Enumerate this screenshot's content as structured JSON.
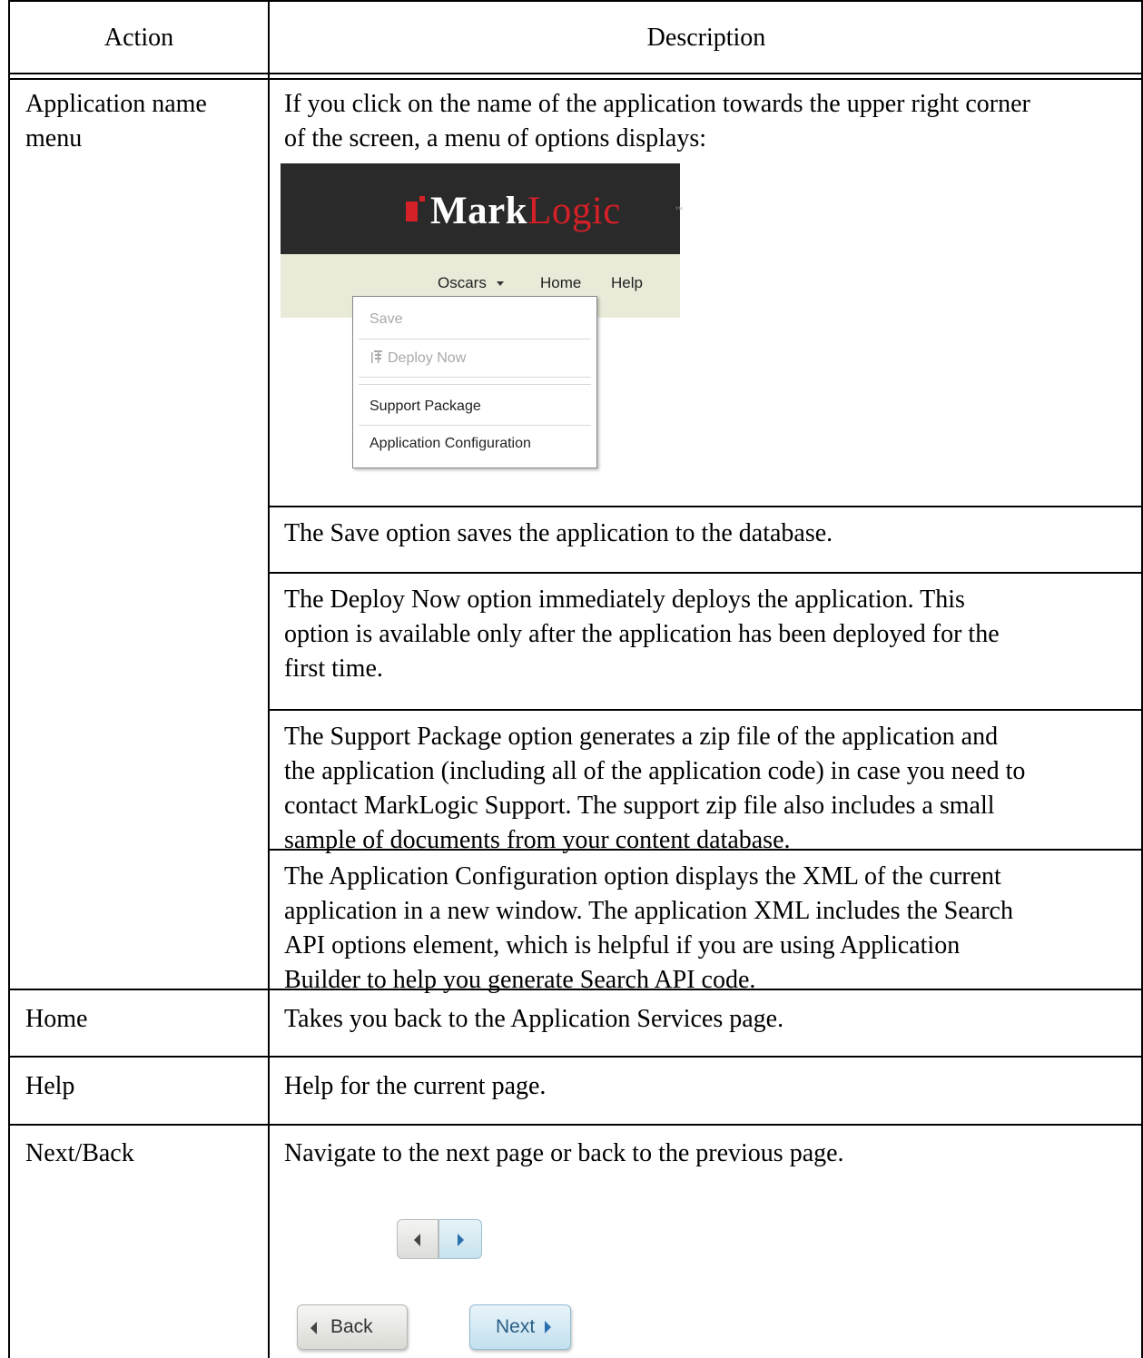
{
  "table": {
    "header": {
      "action": "Action",
      "description": "Description"
    },
    "rows": [
      {
        "action": [
          "Application name",
          "menu"
        ],
        "intro": [
          "If you click on the name of the application towards the upper right corner",
          "of the screen, a menu of options displays:"
        ],
        "sub": [
          [
            "The Save option saves the application to the database."
          ],
          [
            "The Deploy Now option immediately deploys the application. This",
            "option is available only after the application has been deployed for the",
            "first time."
          ],
          [
            "The Support Package option generates a zip file of the application and",
            "the application (including all of the application code) in case you need to",
            "contact MarkLogic Support. The support zip file also includes a small",
            "sample of documents from your content database."
          ],
          [
            "The Application Configuration option displays the XML of the current",
            "application in a new window. The application XML includes the Search",
            "API options element, which is helpful if you are using Application",
            "Builder to help you generate Search API code."
          ]
        ]
      },
      {
        "action": "Home",
        "description": "Takes you back to the Application Services page."
      },
      {
        "action": "Help",
        "description": "Help for the current page."
      },
      {
        "action": "Next/Back",
        "description": "Navigate to the next page or back to the previous page."
      }
    ]
  },
  "screenshot_menu": {
    "logo_mark": "Mark",
    "logo_logic": "Logic",
    "logo_tm": "™",
    "nav": {
      "app_name": "Oscars",
      "home": "Home",
      "help": "Help"
    },
    "menu_items": [
      {
        "label": "Save",
        "enabled": false
      },
      {
        "label": "Deploy Now",
        "enabled": false,
        "icon": "deploy-icon"
      },
      {
        "label": "Support Package",
        "enabled": true
      },
      {
        "label": "Application Configuration",
        "enabled": true
      }
    ],
    "colors": {
      "bar": "#2a2a2a",
      "nav": "#e9ead8",
      "brand_red": "#d42027"
    }
  },
  "screenshot_nav": {
    "back_label": "Back",
    "next_label": "Next"
  }
}
